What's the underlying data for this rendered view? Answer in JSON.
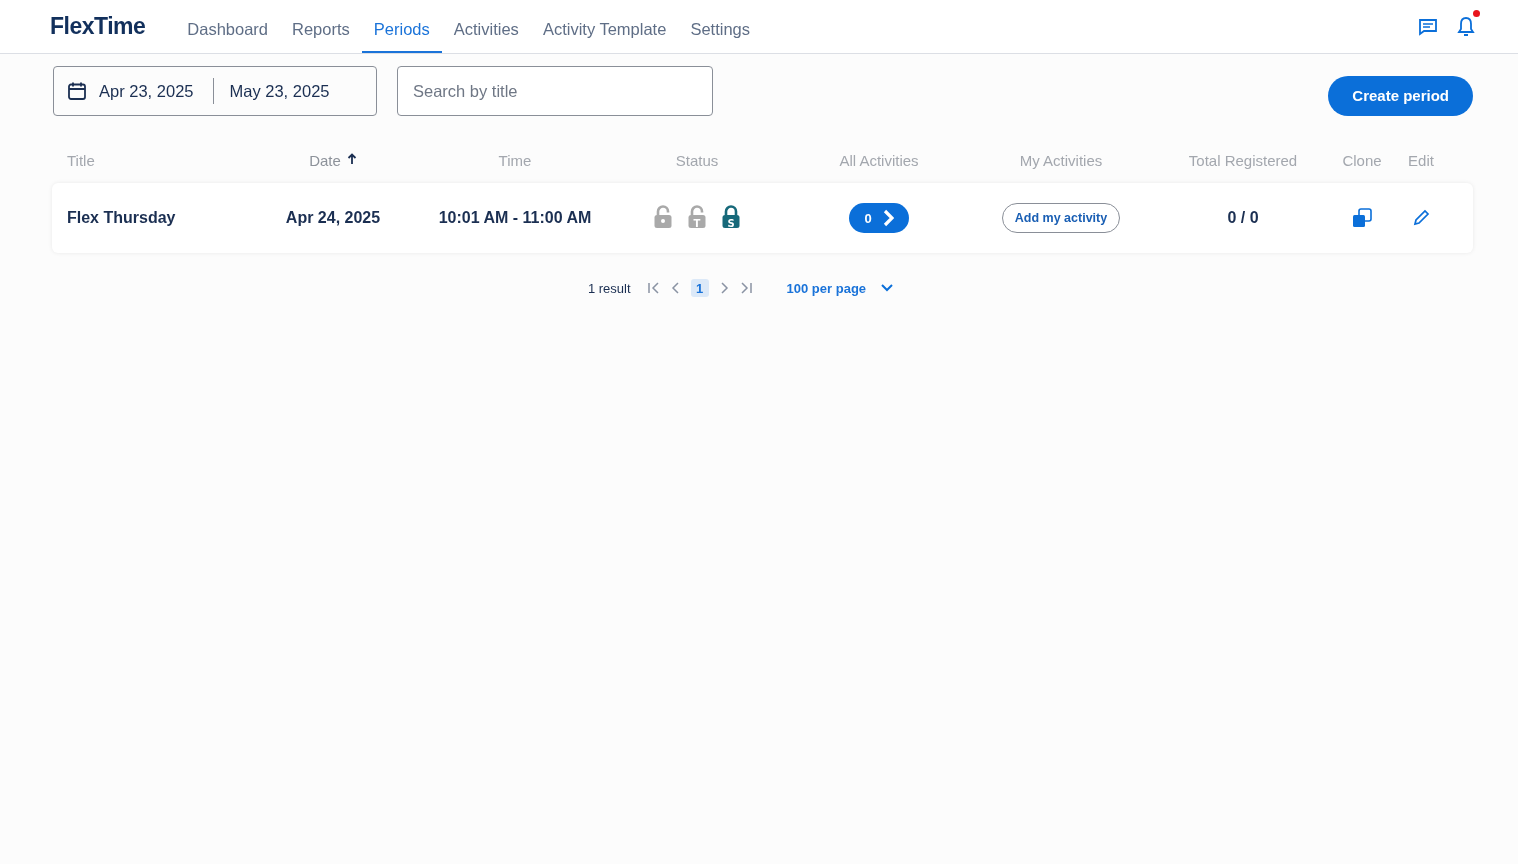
{
  "app": {
    "logo": "FlexTime"
  },
  "nav": [
    {
      "label": "Dashboard",
      "selected": false
    },
    {
      "label": "Reports",
      "selected": false
    },
    {
      "label": "Periods",
      "selected": true
    },
    {
      "label": "Activities",
      "selected": false
    },
    {
      "label": "Activity Template",
      "selected": false
    },
    {
      "label": "Settings",
      "selected": false
    }
  ],
  "header": {
    "notification_dot": true
  },
  "filters": {
    "date_from": "Apr 23, 2025",
    "date_to": "May 23, 2025",
    "search": {
      "placeholder": "Search by title"
    }
  },
  "create_button": "Create period",
  "table": {
    "columns": [
      {
        "label": "Title",
        "sorted": false
      },
      {
        "label": "Date",
        "sorted": true
      },
      {
        "label": "Time",
        "sorted": false
      },
      {
        "label": "Status",
        "sorted": false
      },
      {
        "label": "All Activities",
        "sorted": false
      },
      {
        "label": "My Activities",
        "sorted": false
      },
      {
        "label": "Total Registered",
        "sorted": false
      },
      {
        "label": "Clone",
        "sorted": false
      },
      {
        "label": "Edit",
        "sorted": false
      }
    ],
    "rows": [
      {
        "title": "Flex Thursday",
        "date": "Apr 24, 2025",
        "time": "10:01 AM - 11:00 AM",
        "locks": [
          {
            "locked": false
          },
          {
            "letter": "T",
            "locked": false
          },
          {
            "letter": "S",
            "locked": true
          }
        ],
        "all_activities": "0",
        "my_activities_button": "Add my activity",
        "total_registered": "0 / 0"
      }
    ]
  },
  "pagination": {
    "result_count": "1 result",
    "pages": [
      {
        "label": "1",
        "selected": true
      }
    ],
    "per_page": "100 per page"
  }
}
